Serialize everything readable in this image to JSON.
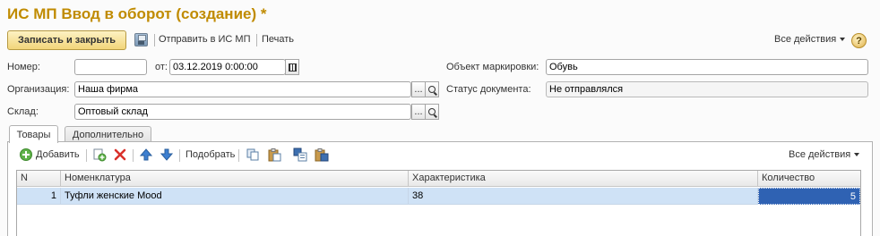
{
  "window": {
    "title": "ИС МП Ввод в оборот (создание) *"
  },
  "toolbar": {
    "save_close_label": "Записать и закрыть",
    "send_label": "Отправить в ИС МП",
    "print_label": "Печать",
    "all_actions_label": "Все действия",
    "help_label": "?"
  },
  "form": {
    "number_label": "Номер:",
    "number_value": "",
    "date_label": "от:",
    "date_value": "03.12.2019  0:00:00",
    "organization_label": "Организация:",
    "organization_value": "Наша фирма",
    "warehouse_label": "Склад:",
    "warehouse_value": "Оптовый склад",
    "marking_object_label": "Объект маркировки:",
    "marking_object_value": "Обувь",
    "doc_status_label": "Статус документа:",
    "doc_status_value": "Не отправлялся",
    "select_btn": "..."
  },
  "tabs": [
    {
      "label": "Товары",
      "active": true
    },
    {
      "label": "Дополнительно",
      "active": false
    }
  ],
  "grid_toolbar": {
    "add_label": "Добавить",
    "pick_label": "Подобрать",
    "all_actions_label": "Все действия"
  },
  "table": {
    "columns": [
      "N",
      "Номенклатура",
      "Характеристика",
      "Количество"
    ],
    "rows": [
      {
        "n": "1",
        "item": "Туфли женские Mood",
        "characteristic": "38",
        "quantity": "5"
      }
    ]
  },
  "colors": {
    "title": "#c08b00",
    "primary_button": "#f2d57a",
    "row_highlight": "#cfe2f6",
    "cell_selected": "#2f62b3",
    "delete_icon": "#d9312b",
    "arrow_icon": "#3d7fd0"
  }
}
